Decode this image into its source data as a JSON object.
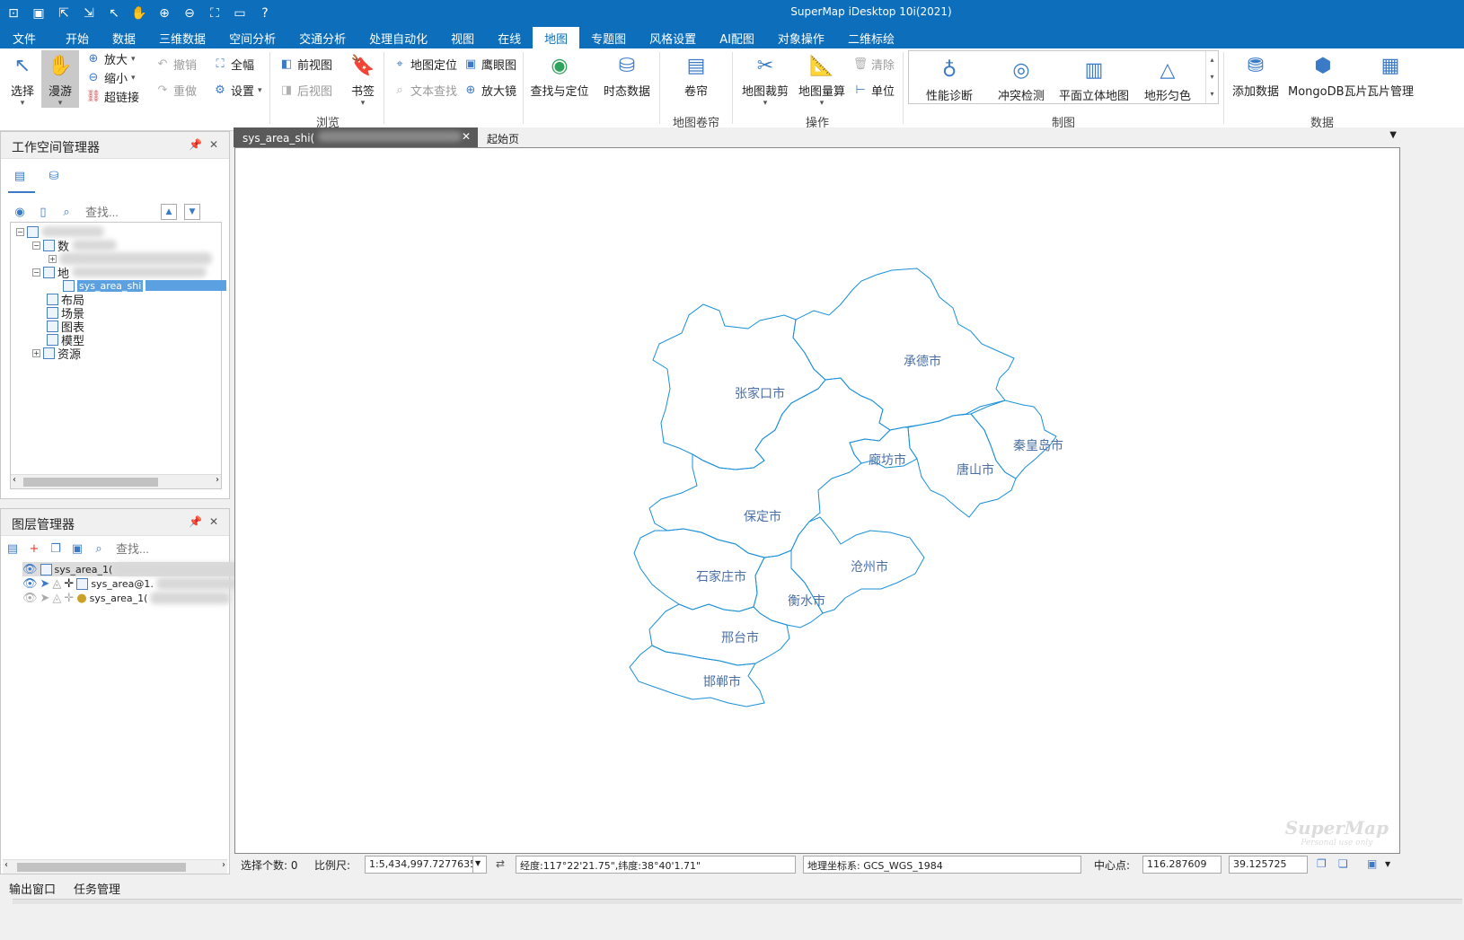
{
  "app": {
    "title": "SuperMap iDesktop 10i(2021)"
  },
  "menu": [
    "文件",
    "开始",
    "数据",
    "三维数据",
    "空间分析",
    "交通分析",
    "处理自动化",
    "视图",
    "在线",
    "地图",
    "专题图",
    "风格设置",
    "AI配图",
    "对象操作",
    "二维标绘"
  ],
  "ribbon": {
    "select": "选择",
    "pan": "漫游",
    "zoom_in": "放大",
    "zoom_out": "缩小",
    "hyperlink": "超链接",
    "undo": "撤销",
    "redo": "重做",
    "full_extent": "全幅",
    "settings": "设置",
    "prev_view": "前视图",
    "next_view": "后视图",
    "bookmark": "书签",
    "map_locate": "地图定位",
    "text_search": "文本查找",
    "eagle_eye": "鹰眼图",
    "magnifier": "放大镜",
    "find_locate": "查找与定位",
    "temporal": "时态数据",
    "browse_group": "浏览",
    "swipe": "卷帘",
    "swipe_group": "地图卷帘",
    "clip": "地图裁剪",
    "measure": "地图量算",
    "clear": "清除",
    "unit": "单位",
    "ops_group": "操作",
    "perf": "性能诊断",
    "conflict": "冲突检测",
    "flat3d": "平面立体地图",
    "terrain": "地形匀色",
    "carto_group": "制图",
    "add_data": "添加数据",
    "mongo": "MongoDB瓦片",
    "tile_mgr": "瓦片管理",
    "data_group": "数据"
  },
  "workspace": {
    "title": "工作空间管理器",
    "search_placeholder": "查找...",
    "tree": {
      "datasource": "数",
      "map_node": "地",
      "map_item": "sys_area_shi",
      "layout": "布局",
      "scene": "场景",
      "chart": "图表",
      "model": "模型",
      "resource": "资源"
    }
  },
  "layers": {
    "title": "图层管理器",
    "search_placeholder": "查找...",
    "items": [
      "sys_area_1(",
      "sys_area@1.",
      "sys_area_1("
    ]
  },
  "doc_tabs": {
    "active": "sys_area_shi(",
    "start": "起始页"
  },
  "map": {
    "cities": [
      "承德市",
      "张家口市",
      "秦皇岛市",
      "廊坊市",
      "唐山市",
      "保定市",
      "沧州市",
      "石家庄市",
      "衡水市",
      "邢台市",
      "邯郸市"
    ],
    "watermark": "SuperMap",
    "watermark_sub": "Personal use only"
  },
  "status": {
    "select_count_label": "选择个数: 0",
    "scale_label": "比例尺:",
    "scale_value": "1:5,434,997.72776351",
    "coords": "经度:117°22'21.75\",纬度:38°40'1.71\"",
    "crs": "地理坐标系: GCS_WGS_1984",
    "center_label": "中心点:",
    "center_x": "116.287609",
    "center_y": "39.125725"
  },
  "bottom": {
    "output": "输出窗口",
    "tasks": "任务管理"
  }
}
